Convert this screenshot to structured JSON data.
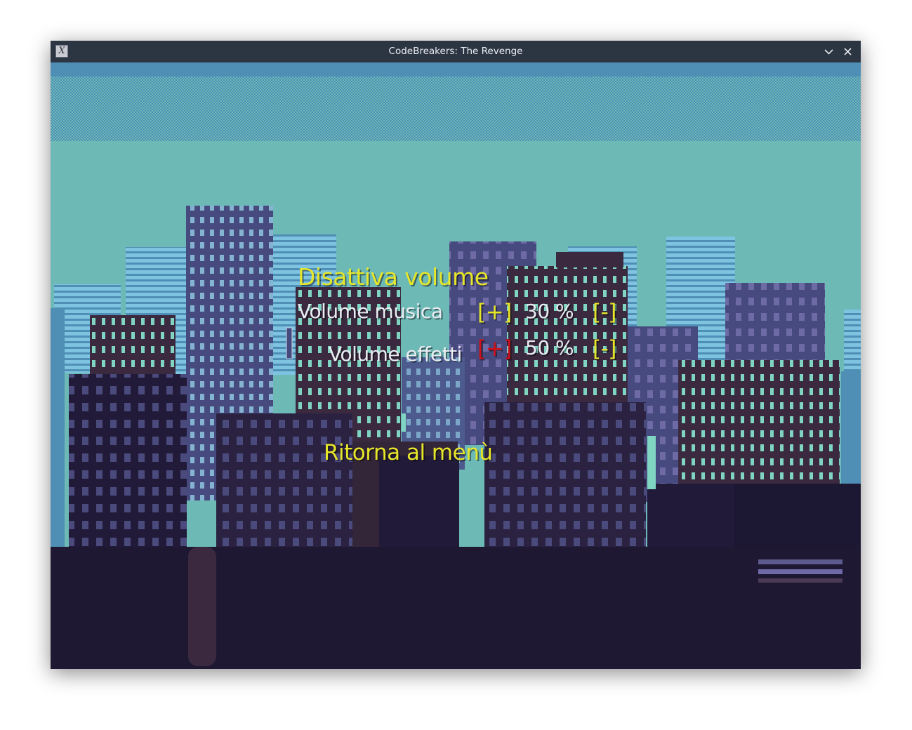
{
  "window": {
    "title": "CodeBreakers: The Revenge",
    "app_icon": "X"
  },
  "menu": {
    "mute_label": "Disattiva volume",
    "music": {
      "label": "Volume musica",
      "plus": "[+]",
      "value": "30 %",
      "minus": "[-]"
    },
    "effects": {
      "label": "Volume effetti",
      "plus": "[+]",
      "value": "50 %",
      "minus": "[-]"
    },
    "back_label": "Ritorna al menù"
  },
  "colors": {
    "menu_yellow": "#e6e62a",
    "menu_white": "#e9ecf2",
    "active_red": "#d1101a",
    "sky_teal": "#6cb9b6",
    "night_purple": "#1f1833"
  },
  "icons": {
    "app": "app-x-icon",
    "minimize": "chevron-down-icon",
    "close": "close-icon"
  }
}
